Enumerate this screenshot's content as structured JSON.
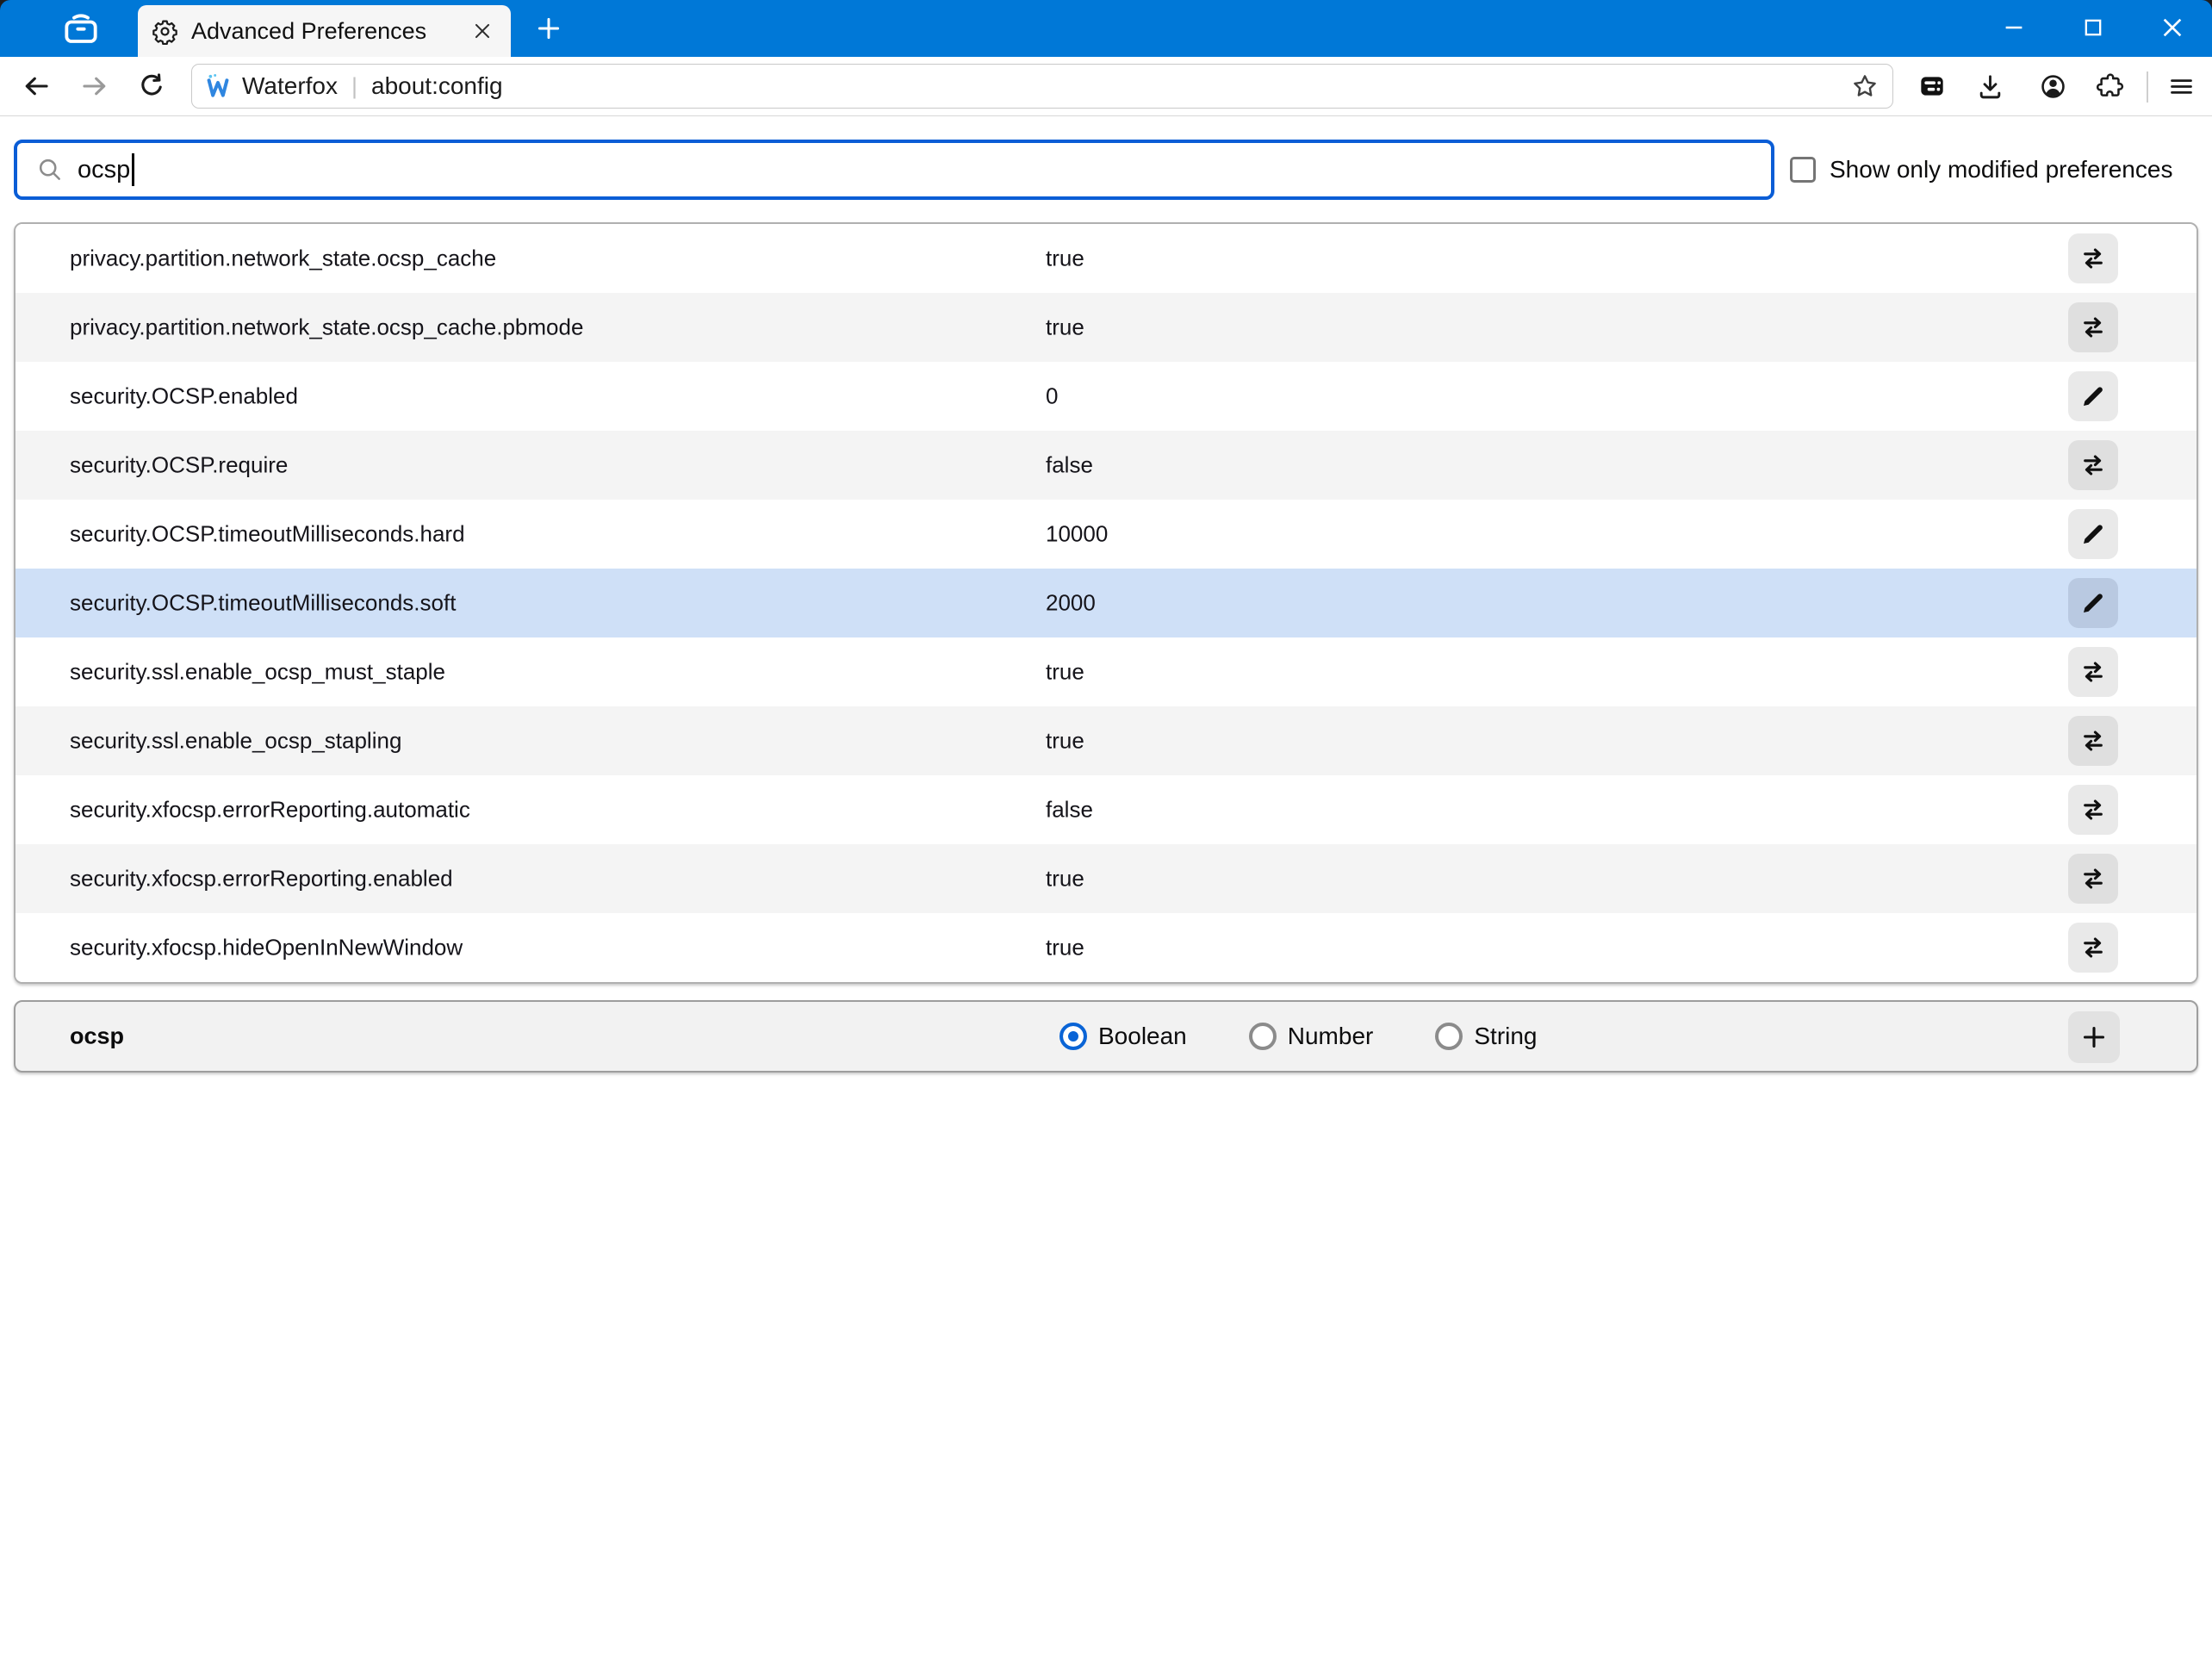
{
  "window": {
    "controls": [
      {
        "name": "minimize"
      },
      {
        "name": "maximize"
      },
      {
        "name": "close"
      }
    ]
  },
  "tab_bar": {
    "firefox_view_icon": "firefox-view-icon",
    "tab": {
      "title": "Advanced Preferences",
      "icon": "gear-icon",
      "close_icon": "close-icon"
    },
    "new_tab_icon": "plus-icon"
  },
  "toolbar": {
    "back_icon": "back-arrow-icon",
    "forward_icon": "forward-arrow-icon",
    "reload_icon": "reload-icon",
    "url_bar": {
      "brand": "Waterfox",
      "separator": "|",
      "address": "about:config",
      "bookmark_icon": "star-icon"
    },
    "right_icons": [
      "storage-icon",
      "download-icon",
      "account-icon",
      "extensions-icon",
      "menu-icon"
    ]
  },
  "search": {
    "value": "ocsp",
    "icon": "magnifier-icon"
  },
  "filter_checkbox": {
    "label": "Show only modified preferences",
    "checked": false
  },
  "prefs_table": {
    "rows": [
      {
        "name": "privacy.partition.network_state.ocsp_cache",
        "value": "true",
        "action": "toggle",
        "highlighted": false
      },
      {
        "name": "privacy.partition.network_state.ocsp_cache.pbmode",
        "value": "true",
        "action": "toggle",
        "highlighted": false
      },
      {
        "name": "security.OCSP.enabled",
        "value": "0",
        "action": "edit",
        "highlighted": false
      },
      {
        "name": "security.OCSP.require",
        "value": "false",
        "action": "toggle",
        "highlighted": false
      },
      {
        "name": "security.OCSP.timeoutMilliseconds.hard",
        "value": "10000",
        "action": "edit",
        "highlighted": false
      },
      {
        "name": "security.OCSP.timeoutMilliseconds.soft",
        "value": "2000",
        "action": "edit",
        "highlighted": true
      },
      {
        "name": "security.ssl.enable_ocsp_must_staple",
        "value": "true",
        "action": "toggle",
        "highlighted": false
      },
      {
        "name": "security.ssl.enable_ocsp_stapling",
        "value": "true",
        "action": "toggle",
        "highlighted": false
      },
      {
        "name": "security.xfocsp.errorReporting.automatic",
        "value": "false",
        "action": "toggle",
        "highlighted": false
      },
      {
        "name": "security.xfocsp.errorReporting.enabled",
        "value": "true",
        "action": "toggle",
        "highlighted": false
      },
      {
        "name": "security.xfocsp.hideOpenInNewWindow",
        "value": "true",
        "action": "toggle",
        "highlighted": false
      }
    ]
  },
  "add_preference_row": {
    "name": "ocsp",
    "type_options": [
      {
        "label": "Boolean",
        "selected": true
      },
      {
        "label": "Number",
        "selected": false
      },
      {
        "label": "String",
        "selected": false
      }
    ],
    "add_icon": "plus-icon"
  },
  "colors": {
    "accent_blue": "#0078d7",
    "search_focus_blue": "#0a5dd6",
    "row_highlight": "#cfe0f7",
    "row_stripe": "#f4f4f4",
    "radio_selected_blue": "#0a64d6"
  }
}
